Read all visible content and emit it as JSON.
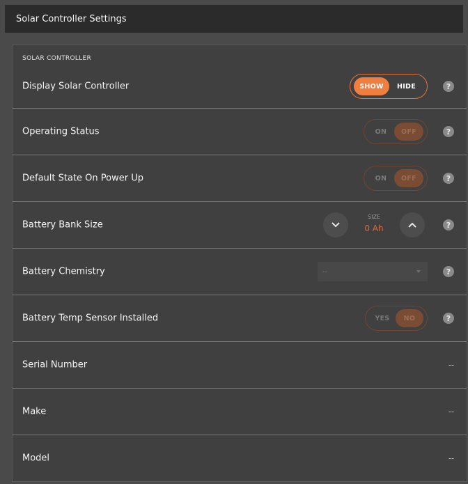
{
  "window": {
    "title": "Solar Controller Settings"
  },
  "section": {
    "label": "SOLAR CONTROLLER"
  },
  "help_label": "?",
  "rows": {
    "display": {
      "label": "Display Solar Controller",
      "on_label": "SHOW",
      "off_label": "HIDE",
      "selected": "SHOW"
    },
    "operating": {
      "label": "Operating Status",
      "on_label": "ON",
      "off_label": "OFF",
      "selected": "OFF"
    },
    "default_state": {
      "label": "Default State On Power Up",
      "on_label": "ON",
      "off_label": "OFF",
      "selected": "OFF"
    },
    "battery_size": {
      "label": "Battery Bank Size",
      "stepper_label": "SIZE",
      "value": "0 Ah"
    },
    "chemistry": {
      "label": "Battery Chemistry",
      "selected_value": "--"
    },
    "temp_sensor": {
      "label": "Battery Temp Sensor Installed",
      "on_label": "YES",
      "off_label": "NO",
      "selected": "NO"
    },
    "serial": {
      "label": "Serial Number",
      "value": "--"
    },
    "make": {
      "label": "Make",
      "value": "--"
    },
    "model": {
      "label": "Model",
      "value": "--"
    }
  },
  "colors": {
    "accent": "#f07e3f",
    "accent_dim": "#7a4c34",
    "panel": "#404040",
    "titlebar": "#2b2b2b"
  }
}
